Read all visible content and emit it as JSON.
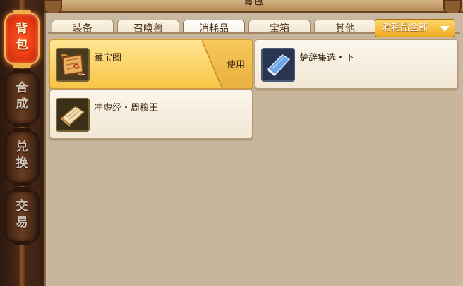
{
  "window": {
    "title": "背包"
  },
  "sidebar": {
    "items": [
      {
        "label": "背\n包",
        "active": true
      },
      {
        "label": "合\n成",
        "active": false
      },
      {
        "label": "兑\n换",
        "active": false
      },
      {
        "label": "交\n易",
        "active": false
      }
    ]
  },
  "tabs": [
    {
      "label": "装备"
    },
    {
      "label": "召唤兽"
    },
    {
      "label": "消耗品"
    },
    {
      "label": "宝箱"
    },
    {
      "label": "其他"
    }
  ],
  "filter": {
    "selected": "消耗品全部"
  },
  "items": [
    {
      "name": "藏宝图",
      "quantity": "5",
      "icon": "treasure-map-icon",
      "selected": true,
      "action_label": "使用"
    },
    {
      "name": "楚辞集选・下",
      "icon": "blue-book-icon",
      "selected": false
    },
    {
      "name": "冲虚经・周穆王",
      "icon": "scroll-book-icon",
      "selected": false
    }
  ],
  "colors": {
    "active_tab_glow": "#ff5a22",
    "selected_card": "#f7c546",
    "dropdown": "#f0a820"
  }
}
